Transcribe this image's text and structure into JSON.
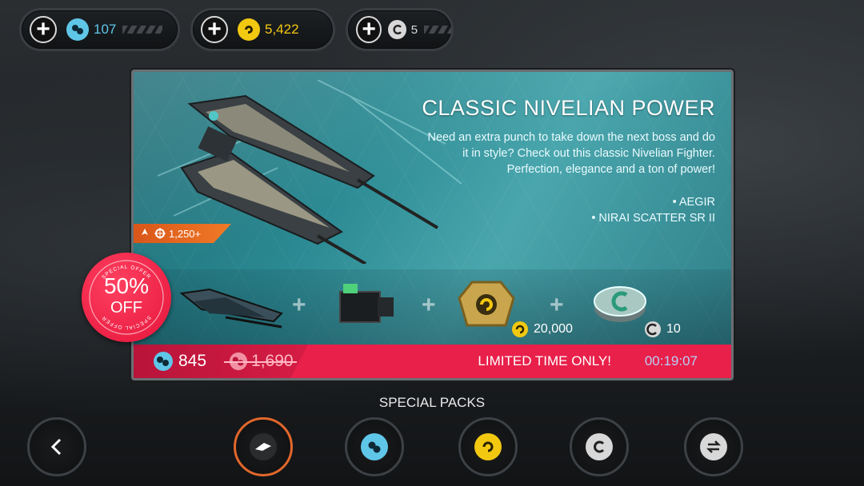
{
  "currencies": [
    {
      "name": "nivelian-crystals",
      "amount": "107",
      "color": "#5fc6e8"
    },
    {
      "name": "credits",
      "amount": "5,422",
      "color": "#f2c811"
    },
    {
      "name": "tokens",
      "amount": "5",
      "color": "#d8d8d8"
    }
  ],
  "offer": {
    "title": "CLASSIC NIVELIAN POWER",
    "description": "Need an extra punch to take down the next boss and do it in style? Check out this classic Nivelian Fighter. Perfection, elegance and a ton of power!",
    "items": [
      "• AEGIR",
      "• NIRAI SCATTER SR II"
    ],
    "power": "1,250+",
    "bundle": {
      "credits_amount": "20,000",
      "tokens_amount": "10"
    },
    "price_now": "845",
    "price_old": "1,690",
    "limited_label": "LIMITED TIME ONLY!",
    "timer": "00:19:07"
  },
  "badge": {
    "top": "SPECIAL OFFER",
    "percent": "50%",
    "off": "OFF",
    "bottom": "SPECIAL OFFER"
  },
  "section_label": "SPECIAL PACKS",
  "nav": {
    "back_icon": "chevron-left-icon",
    "categories": [
      {
        "name": "special-packs",
        "icon": "ship-icon",
        "active": true
      },
      {
        "name": "crystals",
        "icon": "crystal-icon",
        "active": false
      },
      {
        "name": "credits",
        "icon": "credit-icon",
        "active": false
      },
      {
        "name": "tokens",
        "icon": "token-icon",
        "active": false
      },
      {
        "name": "exchange",
        "icon": "exchange-icon",
        "active": false
      }
    ]
  },
  "colors": {
    "accent_orange": "#e2672c",
    "price_bar": "#e8204a",
    "timer": "#b8cff7",
    "panel_teal": "#2b8a93"
  }
}
